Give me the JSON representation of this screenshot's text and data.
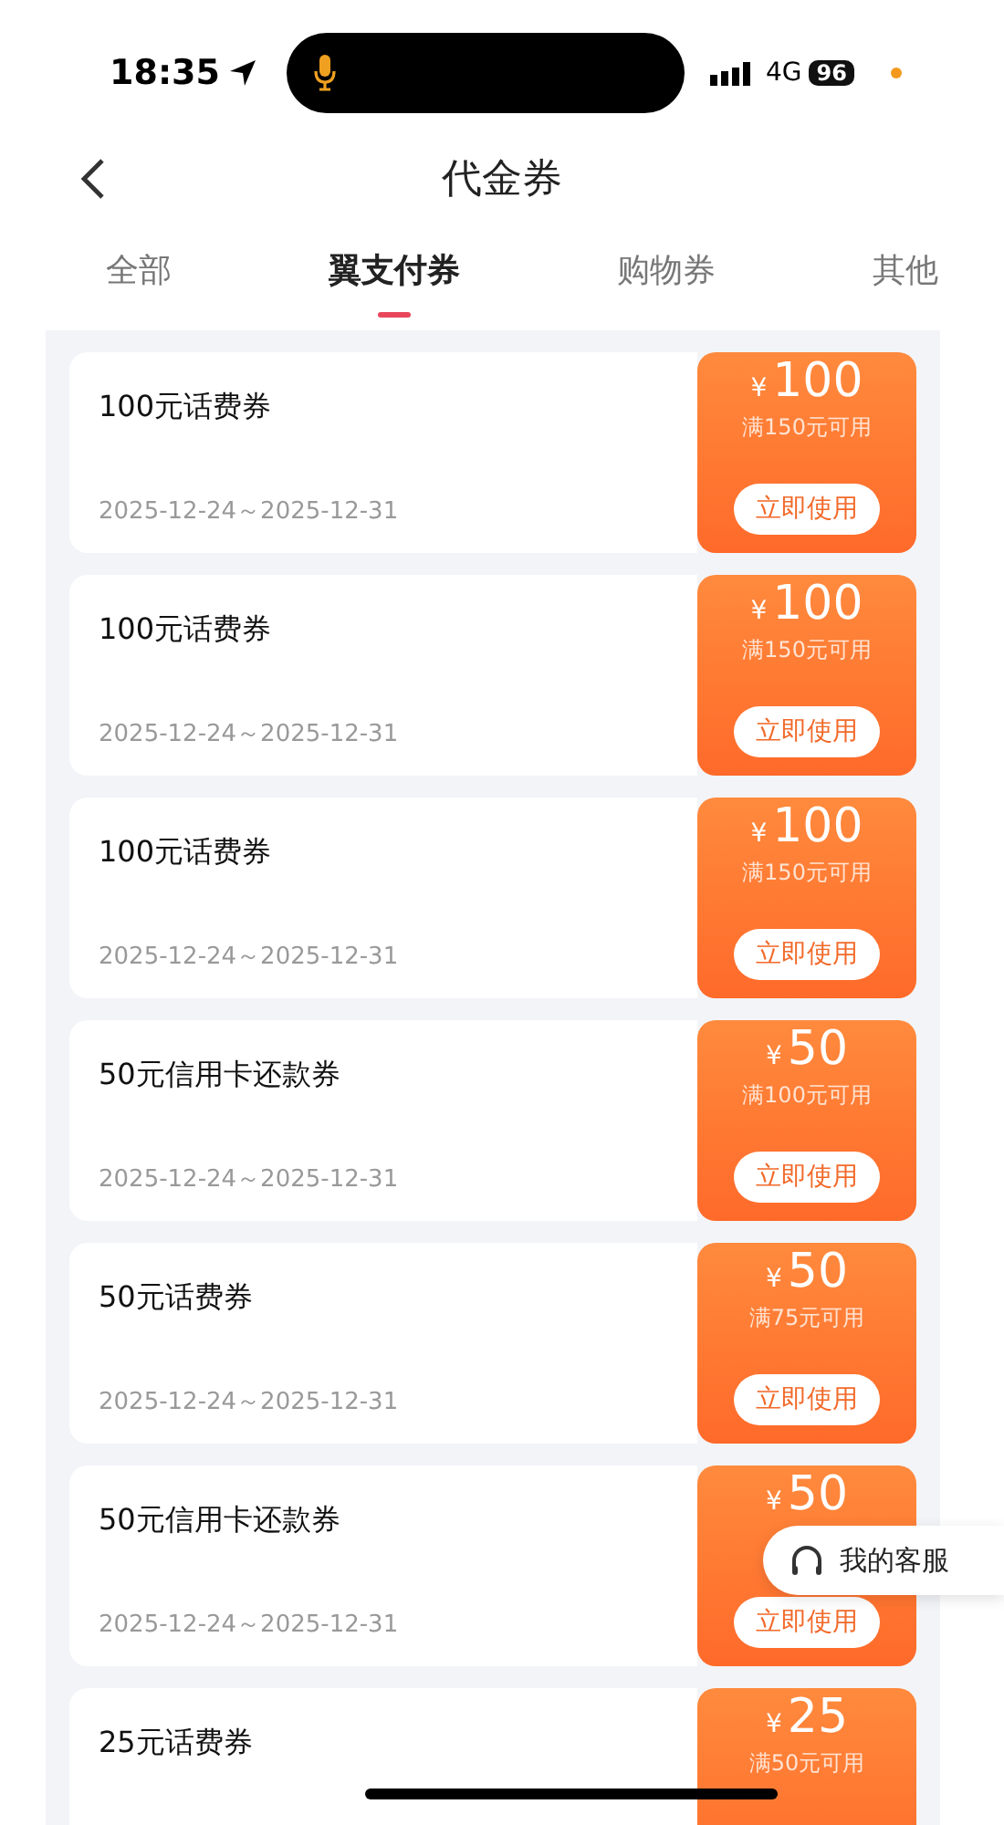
{
  "status_bar": {
    "time": "18:35",
    "network": "4G",
    "battery": "96"
  },
  "header": {
    "title": "代金券"
  },
  "tabs": [
    {
      "label": "全部",
      "selected": false
    },
    {
      "label": "翼支付券",
      "selected": true
    },
    {
      "label": "购物券",
      "selected": false
    },
    {
      "label": "其他",
      "selected": false
    }
  ],
  "coupons": [
    {
      "title": "100元话费券",
      "dates": "2025-12-24～2025-12-31",
      "currency": "¥",
      "amount": "100",
      "condition": "满150元可用",
      "button": "立即使用"
    },
    {
      "title": "100元话费券",
      "dates": "2025-12-24～2025-12-31",
      "currency": "¥",
      "amount": "100",
      "condition": "满150元可用",
      "button": "立即使用"
    },
    {
      "title": "100元话费券",
      "dates": "2025-12-24～2025-12-31",
      "currency": "¥",
      "amount": "100",
      "condition": "满150元可用",
      "button": "立即使用"
    },
    {
      "title": "50元信用卡还款券",
      "dates": "2025-12-24～2025-12-31",
      "currency": "¥",
      "amount": "50",
      "condition": "满100元可用",
      "button": "立即使用"
    },
    {
      "title": "50元话费券",
      "dates": "2025-12-24～2025-12-31",
      "currency": "¥",
      "amount": "50",
      "condition": "满75元可用",
      "button": "立即使用"
    },
    {
      "title": "50元信用卡还款券",
      "dates": "2025-12-24～2025-12-31",
      "currency": "¥",
      "amount": "50",
      "button": "立即使用"
    },
    {
      "title": "25元话费券",
      "currency": "¥",
      "amount": "25",
      "condition": "满50元可用"
    }
  ],
  "service_button": {
    "label": "我的客服"
  }
}
